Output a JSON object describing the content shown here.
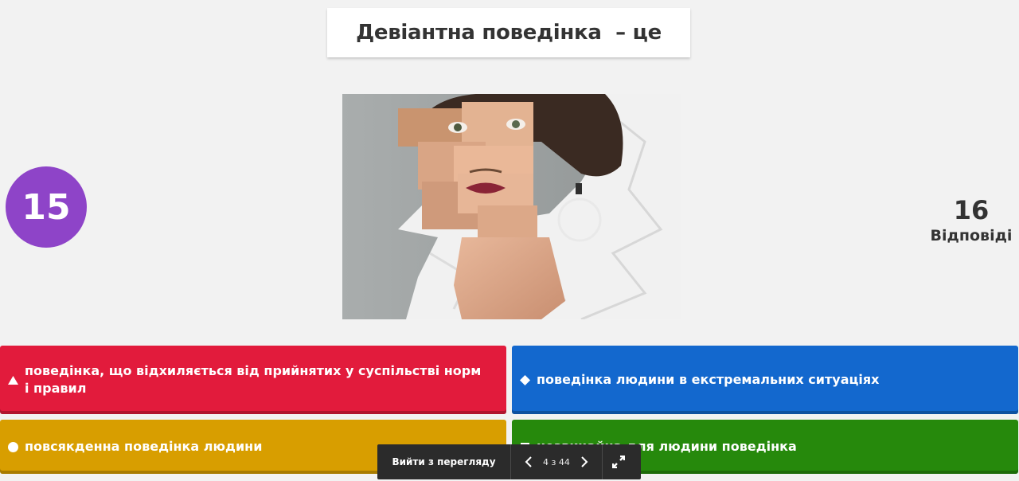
{
  "question": {
    "text": "Девіантна поведінка  – це"
  },
  "timer": {
    "value": "15",
    "color": "#8e44c8"
  },
  "answers_counter": {
    "count": "16",
    "label": "Відповіді"
  },
  "answers": [
    {
      "shape": "triangle-icon",
      "text": "поведінка, що відхиляється від прийнятих у суспільстві норм і правил",
      "color": "#e21b3c"
    },
    {
      "shape": "diamond-icon",
      "text": "поведінка людини в екстремальних ситуаціях",
      "color": "#1368ce"
    },
    {
      "shape": "circle-icon",
      "text": "повсякденна поведінка людини",
      "color": "#d89e00"
    },
    {
      "shape": "square-icon",
      "text": "незвичайна для людини поведінка",
      "color": "#26890c"
    }
  ],
  "toolbar": {
    "exit_label": "Вийти з перегляду",
    "page_indicator": "4 з 44",
    "prev_icon": "chevron-left-icon",
    "next_icon": "chevron-right-icon",
    "fullscreen_icon": "fullscreen-icon"
  }
}
